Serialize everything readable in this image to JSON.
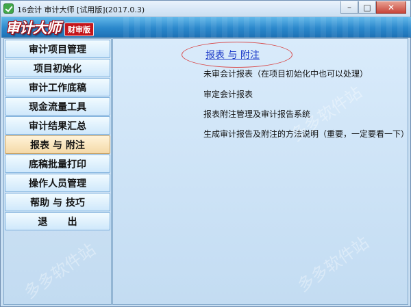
{
  "window": {
    "title": "16会计  审计大师 [试用版](2017.0.3)",
    "buttons": {
      "minimize": "–",
      "maximize": "□",
      "close": "✕"
    }
  },
  "banner": {
    "logo": "审计大师",
    "edition": "财审版"
  },
  "sidebar": {
    "items": [
      {
        "label": "审计项目管理"
      },
      {
        "label": "项目初始化"
      },
      {
        "label": "审计工作底稿"
      },
      {
        "label": "现金流量工具"
      },
      {
        "label": "审计结果汇总"
      },
      {
        "label": "报表 与 附注"
      },
      {
        "label": "底稿批量打印"
      },
      {
        "label": "操作人员管理"
      },
      {
        "label": "帮助 与 技巧"
      },
      {
        "label": "退      出"
      }
    ],
    "active_index": 5
  },
  "content": {
    "title": "报表 与 附注",
    "links": [
      {
        "label": "未审会计报表（在项目初始化中也可以处理）"
      },
      {
        "label": "审定会计报表"
      },
      {
        "label": "报表附注管理及审计报告系统"
      },
      {
        "label": "生成审计报告及附注的方法说明（重要，一定要看一下）"
      }
    ]
  },
  "watermark": "多多软件站",
  "colors": {
    "banner": "#2b88cc",
    "active_item": "#f4d9a8",
    "title_link": "#1a38c8",
    "highlight_oval": "#d84848"
  }
}
